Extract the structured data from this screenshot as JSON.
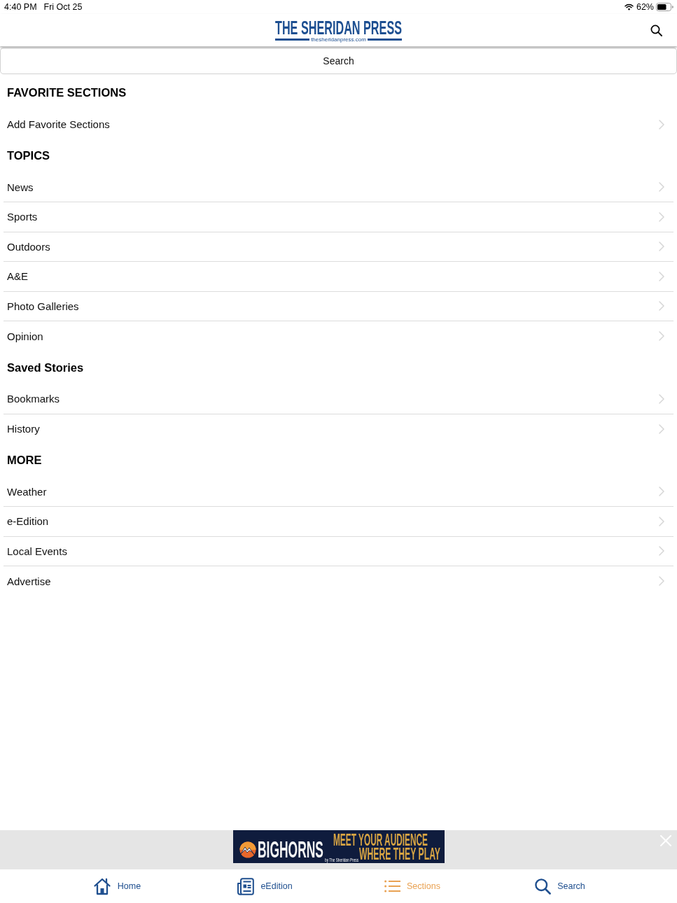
{
  "status_bar": {
    "time": "4:40 PM",
    "date": "Fri Oct 25",
    "battery": "62%"
  },
  "header": {
    "logo_title": "THE SHERIDAN PRESS",
    "logo_url": "thesheridanpress.com"
  },
  "search_bar": {
    "label": "Search"
  },
  "sections": [
    {
      "heading": "FAVORITE SECTIONS",
      "items": [
        "Add Favorite Sections"
      ]
    },
    {
      "heading": "TOPICS",
      "items": [
        "News",
        "Sports",
        "Outdoors",
        "A&E",
        "Photo Galleries",
        "Opinion"
      ]
    },
    {
      "heading": "Saved Stories",
      "items": [
        "Bookmarks",
        "History"
      ]
    },
    {
      "heading": "MORE",
      "items": [
        "Weather",
        "e-Edition",
        "Local Events",
        "Advertise"
      ]
    }
  ],
  "ad_banner": {
    "brand": "BIGHORNS",
    "byline": "by The Sheridan Press",
    "headline": [
      "MEET YOUR AUDIENCE",
      "WHERE THEY PLAY"
    ]
  },
  "tab_bar": [
    {
      "kind": "home",
      "label": "Home",
      "selected": false
    },
    {
      "kind": "edition",
      "label": "eEdition",
      "selected": false
    },
    {
      "kind": "sections",
      "label": "Sections",
      "selected": true
    },
    {
      "kind": "search",
      "label": "Search",
      "selected": false
    }
  ]
}
